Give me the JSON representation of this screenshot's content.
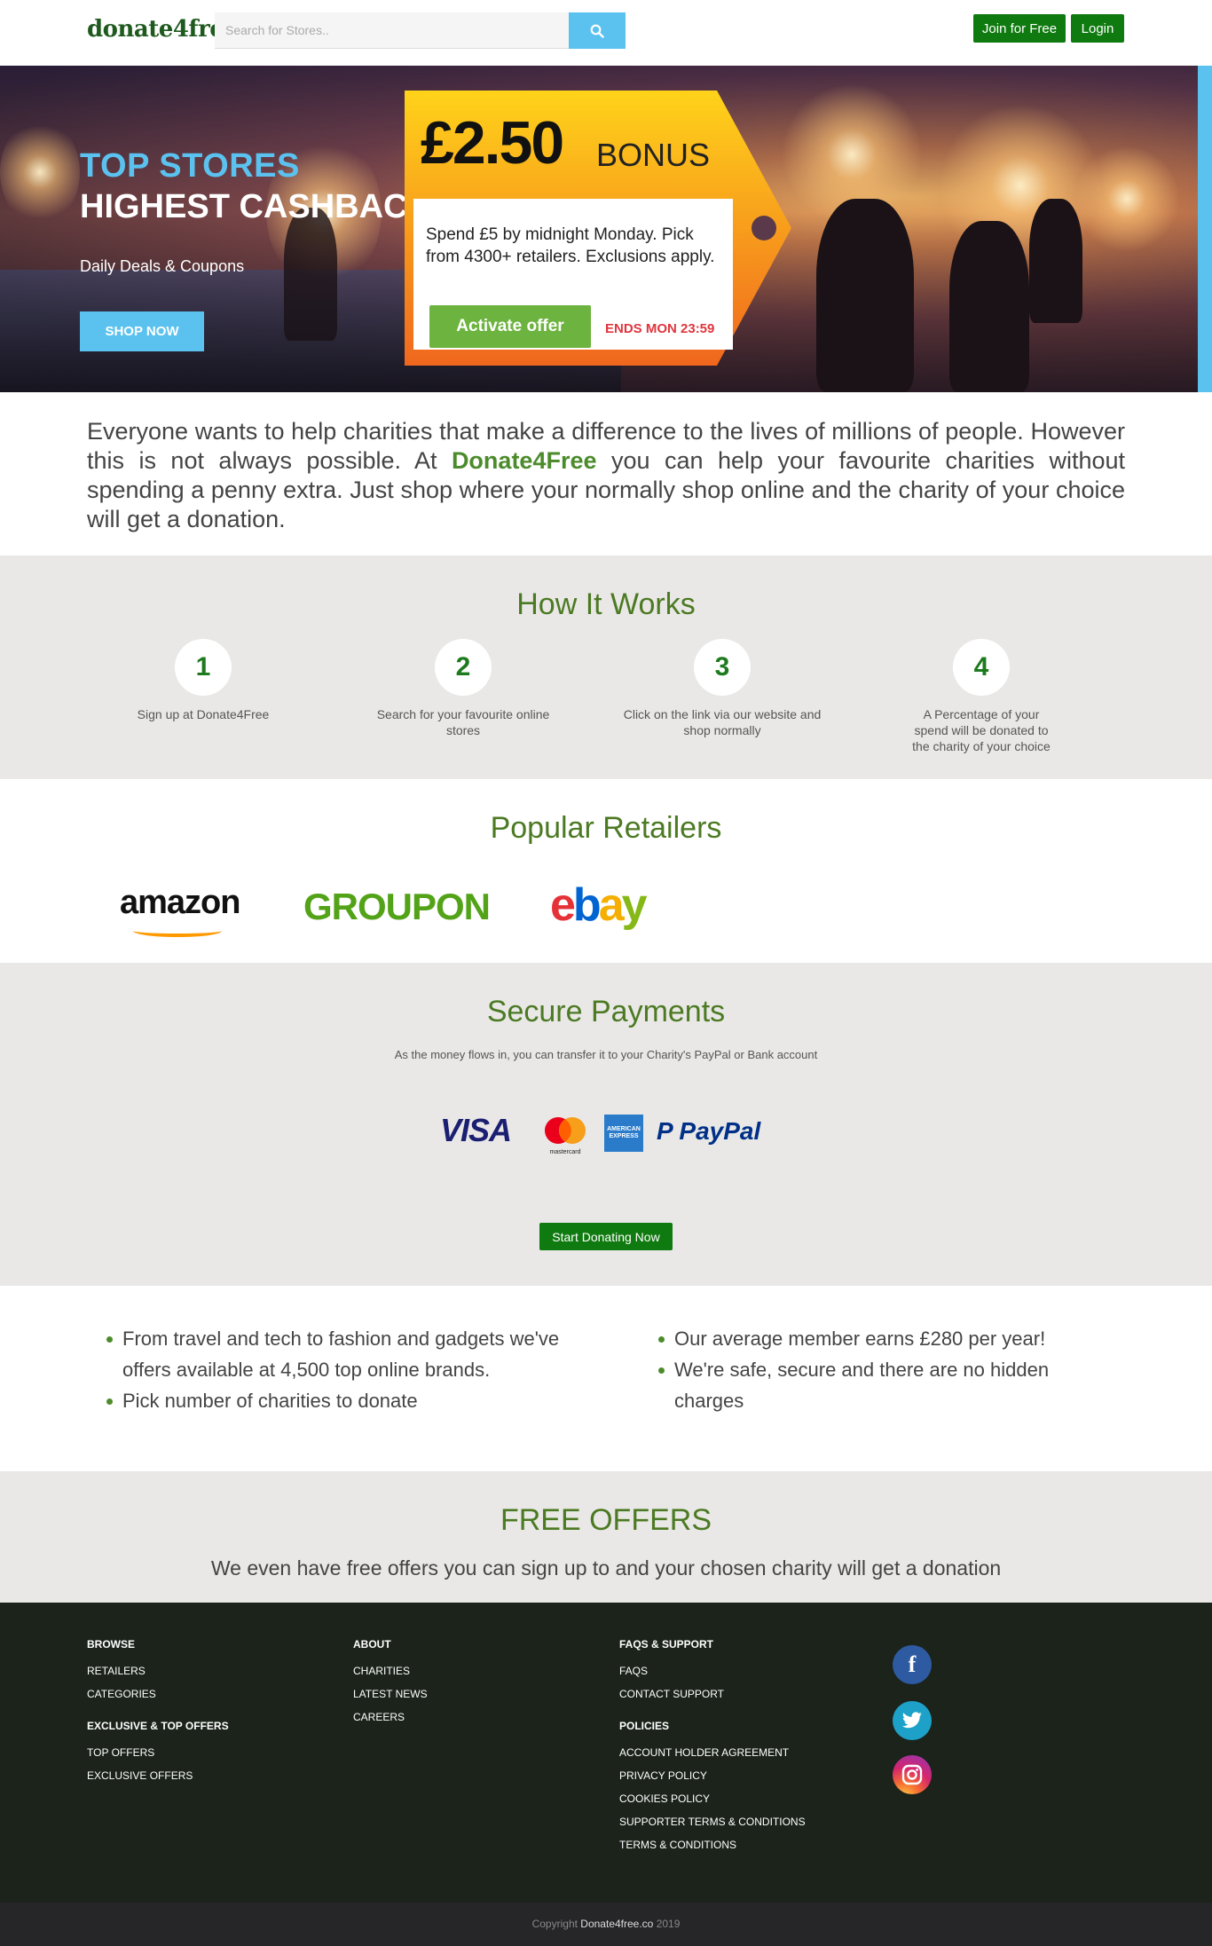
{
  "header": {
    "logo": "donate4free",
    "search_placeholder": "Search for Stores..",
    "join_label": "Join for Free",
    "login_label": "Login"
  },
  "hero": {
    "title_line1": "TOP STORES",
    "title_line2": "HIGHEST CASHBACKS",
    "subtitle": "Daily Deals & Coupons",
    "shop_button": "SHOP NOW",
    "bonus_amount": "£2.50",
    "bonus_word": "BONUS",
    "bonus_text": "Spend £5 by midnight Monday. Pick from 4300+ retailers. Exclusions apply.",
    "activate_label": "Activate offer",
    "ends_label": "ENDS MON 23:59",
    "accent_color": "#5bc2ef"
  },
  "intro": {
    "before": "Everyone wants to help charities that make a difference to the lives of millions of people. However this is not always possible. At ",
    "brand": "Donate4Free",
    "after": " you can help your favourite charities without spending a penny extra. Just shop where your normally shop online and the charity of your choice will get a donation."
  },
  "how": {
    "title": "How It Works",
    "steps": [
      {
        "number": "1",
        "text": "Sign up at Donate4Free"
      },
      {
        "number": "2",
        "text": "Search for your favourite online stores"
      },
      {
        "number": "3",
        "text": "Click on the link via our website and shop normally"
      },
      {
        "number": "4",
        "text": "A Percentage of your spend will be donated to the charity of your choice"
      }
    ]
  },
  "retailers": {
    "title": "Popular Retailers",
    "items": [
      "amazon",
      "GROUPON",
      "ebay"
    ]
  },
  "secure": {
    "title": "Secure Payments",
    "subtitle": "As the money flows in, you can transfer it to your Charity's PayPal or Bank account",
    "visa": "VISA",
    "mastercard": "mastercard",
    "amex": "AMERICAN EXPRESS",
    "paypal": "PayPal",
    "start_label": "Start Donating Now"
  },
  "features": {
    "left": [
      "From travel and tech to fashion and gadgets we've offers available at 4,500 top online brands.",
      "Pick number of charities to donate"
    ],
    "right": [
      "Our average member earns £280 per year!",
      "We're safe, secure and there are no hidden charges"
    ]
  },
  "free": {
    "title": "FREE OFFERS",
    "subtitle": "We even have free offers you can sign up to and your chosen charity will get a donation"
  },
  "footer": {
    "browse": {
      "heading": "BROWSE",
      "links": [
        "RETAILERS",
        "CATEGORIES"
      ]
    },
    "exclusive": {
      "heading": "EXCLUSIVE & TOP OFFERS",
      "links": [
        "TOP OFFERS",
        "EXCLUSIVE OFFERS"
      ]
    },
    "about": {
      "heading": "ABOUT",
      "links": [
        "CHARITIES",
        "LATEST NEWS",
        "CAREERS"
      ]
    },
    "faqs": {
      "heading": "FAQS & SUPPORT",
      "links": [
        "FAQS",
        "CONTACT SUPPORT"
      ]
    },
    "policies": {
      "heading": "POLICIES",
      "links": [
        "ACCOUNT HOLDER AGREEMENT",
        "PRIVACY POLICY",
        "COOKIES POLICY",
        "SUPPORTER TERMS & CONDITIONS",
        "TERMS & CONDITIONS"
      ]
    },
    "social": [
      "facebook-icon",
      "twitter-icon",
      "instagram-icon"
    ]
  },
  "copyright": {
    "prefix": "Copyright ",
    "site": "Donate4free.co",
    "year": " 2019"
  }
}
